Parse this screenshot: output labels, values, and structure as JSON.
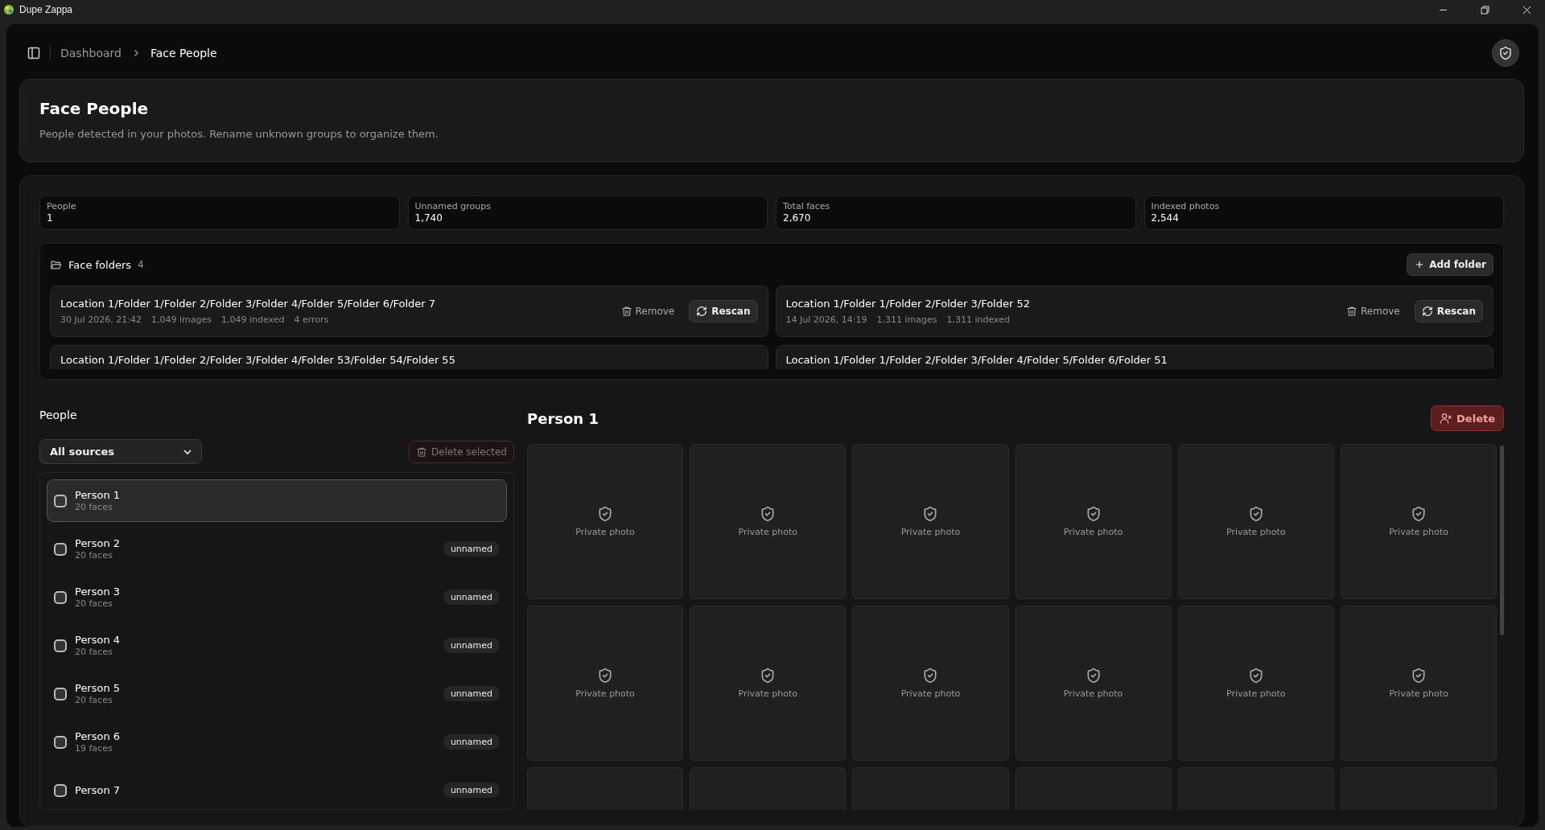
{
  "window": {
    "title": "Dupe Zappa"
  },
  "breadcrumb": [
    {
      "label": "Dashboard",
      "current": false
    },
    {
      "label": "Face People",
      "current": true
    }
  ],
  "header": {
    "title": "Face People",
    "subtitle": "People detected in your photos. Rename unknown groups to organize them."
  },
  "stats": [
    {
      "label": "People",
      "value": "1"
    },
    {
      "label": "Unnamed groups",
      "value": "1,740"
    },
    {
      "label": "Total faces",
      "value": "2,670"
    },
    {
      "label": "Indexed photos",
      "value": "2,544"
    }
  ],
  "folders": {
    "title": "Face folders",
    "count": "4",
    "add_label": "Add folder",
    "items": [
      {
        "path": "Location 1/Folder 1/Folder 2/Folder 3/Folder 4/Folder 5/Folder 6/Folder 7",
        "meta": [
          "30 Jul 2026, 21:42",
          "1,049 images",
          "1,049 indexed",
          "4 errors"
        ],
        "remove": "Remove",
        "rescan": "Rescan"
      },
      {
        "path": "Location 1/Folder 1/Folder 2/Folder 3/Folder 52",
        "meta": [
          "14 Jul 2026, 14:19",
          "1,311 images",
          "1,311 indexed"
        ],
        "remove": "Remove",
        "rescan": "Rescan"
      },
      {
        "path": "Location 1/Folder 1/Folder 2/Folder 3/Folder 4/Folder 53/Folder 54/Folder 55"
      },
      {
        "path": "Location 1/Folder 1/Folder 2/Folder 3/Folder 4/Folder 5/Folder 6/Folder 51"
      }
    ]
  },
  "people": {
    "title": "People",
    "filter": "All sources",
    "delete_selected": {
      "label": "Delete selected",
      "disabled": true
    },
    "items": [
      {
        "name": "Person 1",
        "faces": "20 faces",
        "selected": true,
        "checked": false
      },
      {
        "name": "Person 2",
        "faces": "20 faces",
        "badge": "unnamed",
        "selected": false,
        "checked": false
      },
      {
        "name": "Person 3",
        "faces": "20 faces",
        "badge": "unnamed",
        "selected": false,
        "checked": false
      },
      {
        "name": "Person 4",
        "faces": "20 faces",
        "badge": "unnamed",
        "selected": false,
        "checked": false
      },
      {
        "name": "Person 5",
        "faces": "20 faces",
        "badge": "unnamed",
        "selected": false,
        "checked": false
      },
      {
        "name": "Person 6",
        "faces": "19 faces",
        "badge": "unnamed",
        "selected": false,
        "checked": false
      },
      {
        "name": "Person 7",
        "badge": "unnamed",
        "selected": false,
        "checked": false
      }
    ]
  },
  "detail": {
    "title": "Person 1",
    "delete_label": "Delete",
    "photos": [
      {
        "kind": "private",
        "label": "Private photo"
      },
      {
        "kind": "private",
        "label": "Private photo"
      },
      {
        "kind": "private",
        "label": "Private photo"
      },
      {
        "kind": "private",
        "label": "Private photo"
      },
      {
        "kind": "private",
        "label": "Private photo"
      },
      {
        "kind": "private",
        "label": "Private photo"
      },
      {
        "kind": "private",
        "label": "Private photo"
      },
      {
        "kind": "private",
        "label": "Private photo"
      },
      {
        "kind": "private",
        "label": "Private photo"
      },
      {
        "kind": "private",
        "label": "Private photo"
      },
      {
        "kind": "private",
        "label": "Private photo"
      },
      {
        "kind": "private",
        "label": "Private photo"
      },
      {
        "kind": "partial"
      },
      {
        "kind": "partial"
      },
      {
        "kind": "partial"
      },
      {
        "kind": "partial"
      },
      {
        "kind": "partial"
      },
      {
        "kind": "partial"
      }
    ]
  }
}
